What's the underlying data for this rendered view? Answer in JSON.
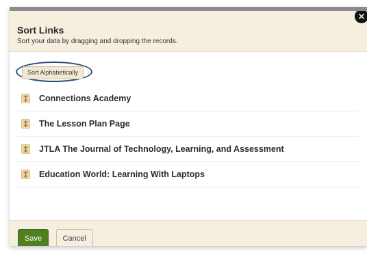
{
  "dialog": {
    "title": "Sort Links",
    "subtitle": "Sort your data by dragging and dropping the records.",
    "close_label": "✕"
  },
  "sort_button": {
    "label": "Sort Alphabetically"
  },
  "links": [
    {
      "label": "Connections Academy",
      "icon": "drag-handle-icon"
    },
    {
      "label": "The Lesson Plan Page",
      "icon": "drag-handle-icon"
    },
    {
      "label": "JTLA The Journal of Technology, Learning, and Assessment",
      "icon": "drag-handle-icon"
    },
    {
      "label": "Education World: Learning With Laptops",
      "icon": "drag-handle-icon"
    }
  ],
  "footer": {
    "save_label": "Save",
    "cancel_label": "Cancel"
  },
  "colors": {
    "header_bg": "#f5efe0",
    "save_bg": "#4f7f1f",
    "highlight_ring": "#2c4a78"
  }
}
